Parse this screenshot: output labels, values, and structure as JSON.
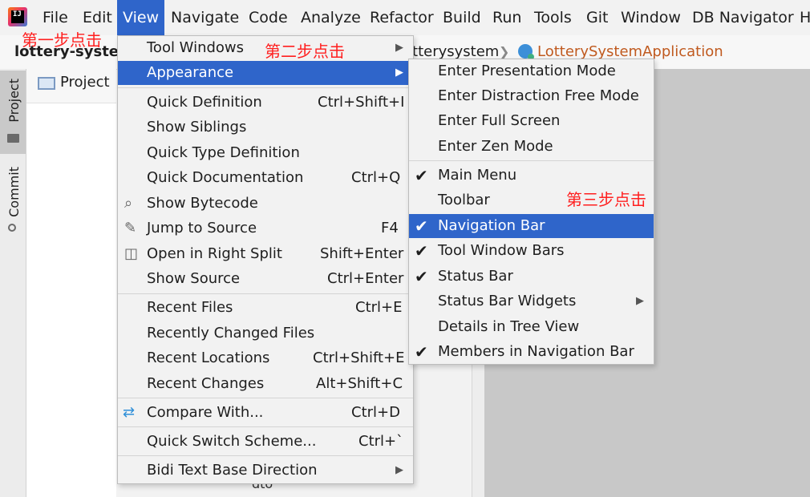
{
  "menubar": {
    "items": [
      {
        "label": "File",
        "active": false
      },
      {
        "label": "Edit",
        "active": false
      },
      {
        "label": "View",
        "active": true
      },
      {
        "label": "Navigate",
        "active": false
      },
      {
        "label": "Code",
        "active": false
      },
      {
        "label": "Analyze",
        "active": false
      },
      {
        "label": "Refactor",
        "active": false
      },
      {
        "label": "Build",
        "active": false
      },
      {
        "label": "Run",
        "active": false
      },
      {
        "label": "Tools",
        "active": false
      },
      {
        "label": "Git",
        "active": false
      },
      {
        "label": "Window",
        "active": false
      },
      {
        "label": "DB Navigator",
        "active": false
      },
      {
        "label": "H",
        "active": false
      }
    ]
  },
  "navbar": {
    "project": "lottery-system",
    "crumb1": "lotterysystem",
    "crumb2": "LotterySystemApplication"
  },
  "annotations": {
    "step1": "第一步点击",
    "step2": "第二步点击",
    "step3": "第三步点击",
    "color": "#ff1f1f"
  },
  "sidebar": {
    "project_tab": "Project",
    "commit_tab": "Commit"
  },
  "project_panel": {
    "title": "Project",
    "behind_item": "dto"
  },
  "view_menu": {
    "items": [
      {
        "label": "Tool Windows",
        "shortcut": "",
        "submenu": true
      },
      {
        "label": "Appearance",
        "shortcut": "",
        "submenu": true,
        "highlighted": true
      },
      {
        "label": "Quick Definition",
        "shortcut": "Ctrl+Shift+I"
      },
      {
        "label": "Show Siblings",
        "shortcut": ""
      },
      {
        "label": "Quick Type Definition",
        "shortcut": ""
      },
      {
        "label": "Quick Documentation",
        "shortcut": "Ctrl+Q"
      },
      {
        "label": "Show Bytecode",
        "shortcut": "",
        "icon": "bytecode-icon"
      },
      {
        "label": "Jump to Source",
        "shortcut": "F4",
        "icon": "pencil-icon"
      },
      {
        "label": "Open in Right Split",
        "shortcut": "Shift+Enter",
        "icon": "split-icon"
      },
      {
        "label": "Show Source",
        "shortcut": "Ctrl+Enter"
      },
      {
        "label": "Recent Files",
        "shortcut": "Ctrl+E"
      },
      {
        "label": "Recently Changed Files",
        "shortcut": ""
      },
      {
        "label": "Recent Locations",
        "shortcut": "Ctrl+Shift+E"
      },
      {
        "label": "Recent Changes",
        "shortcut": "Alt+Shift+C"
      },
      {
        "label": "Compare With...",
        "shortcut": "Ctrl+D",
        "icon": "compare-icon"
      },
      {
        "label": "Quick Switch Scheme...",
        "shortcut": "Ctrl+`"
      },
      {
        "label": "Bidi Text Base Direction",
        "shortcut": "",
        "submenu": true
      }
    ]
  },
  "appearance_menu": {
    "items": [
      {
        "label": "Enter Presentation Mode",
        "checked": false
      },
      {
        "label": "Enter Distraction Free Mode",
        "checked": false
      },
      {
        "label": "Enter Full Screen",
        "checked": false
      },
      {
        "label": "Enter Zen Mode",
        "checked": false
      },
      {
        "label": "Main Menu",
        "checked": true
      },
      {
        "label": "Toolbar",
        "checked": false
      },
      {
        "label": "Navigation Bar",
        "checked": true,
        "highlighted": true
      },
      {
        "label": "Tool Window Bars",
        "checked": true
      },
      {
        "label": "Status Bar",
        "checked": true
      },
      {
        "label": "Status Bar Widgets",
        "checked": false,
        "submenu": true
      },
      {
        "label": "Details in Tree View",
        "checked": false
      },
      {
        "label": "Members in Navigation Bar",
        "checked": true
      }
    ]
  },
  "colors": {
    "highlight": "#2f65ca",
    "menu_bg": "#f2f2f2",
    "annotation": "#ff1f1f",
    "class_name": "#c05a1f"
  }
}
